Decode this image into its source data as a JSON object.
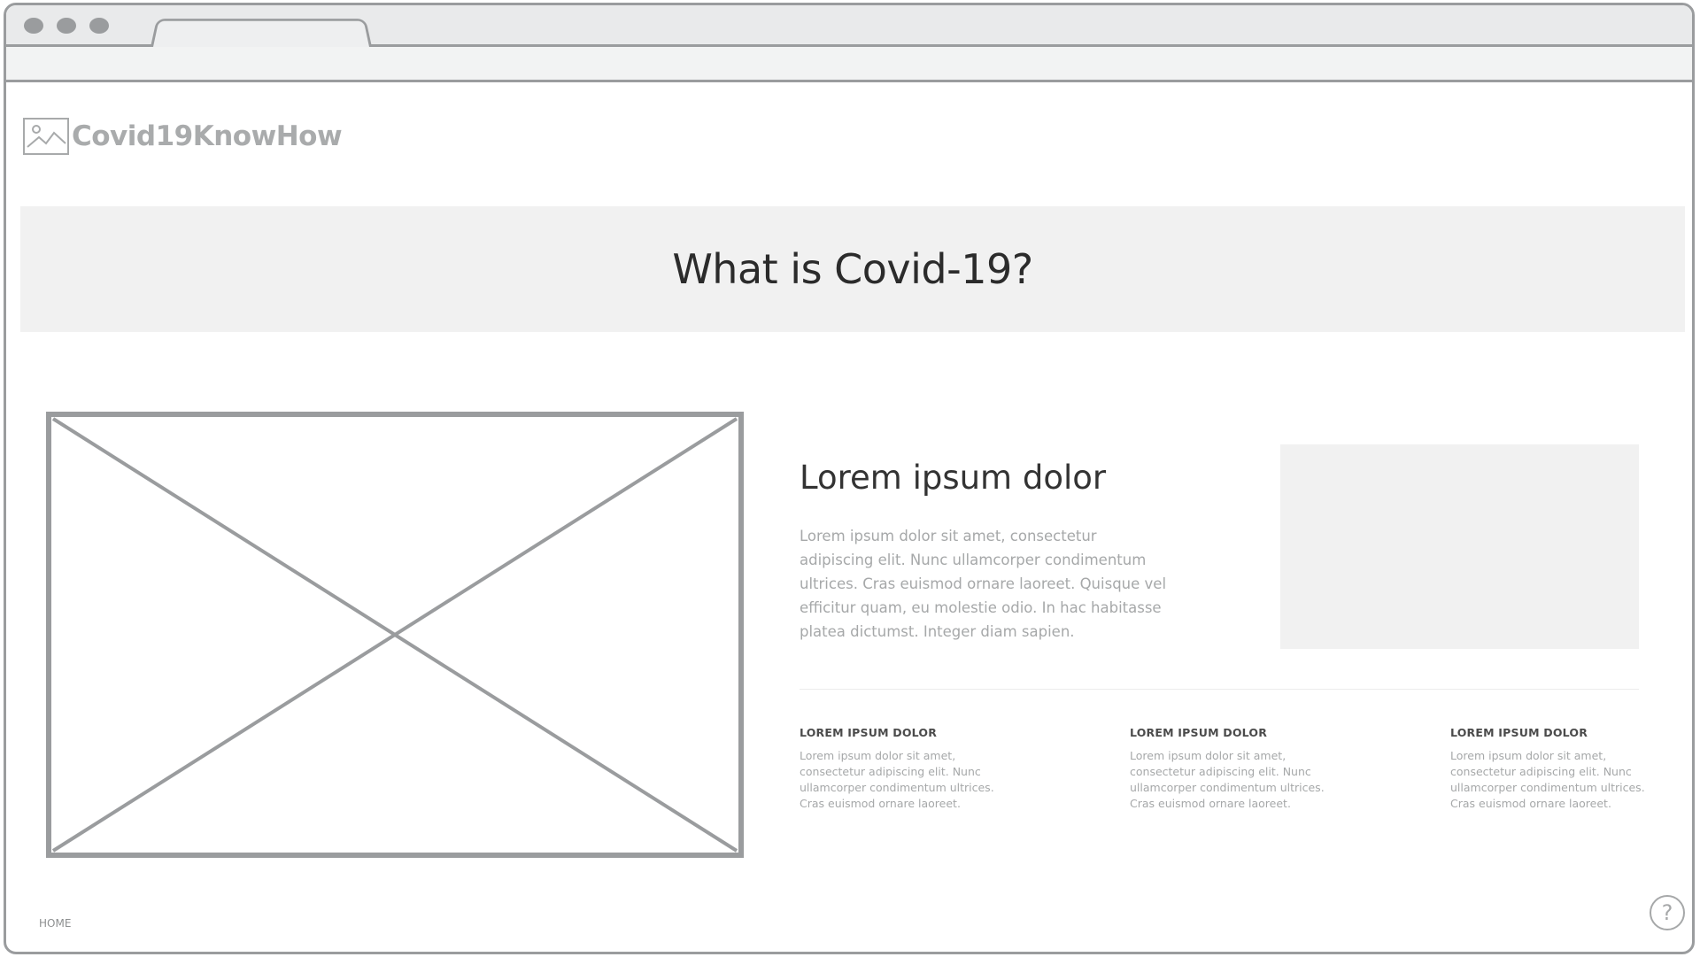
{
  "brand": {
    "name": "Covid19KnowHow",
    "logo_icon": "image-placeholder-icon"
  },
  "hero": {
    "title": "What is Covid-19?"
  },
  "main": {
    "media_icon": "image-placeholder",
    "headline": "Lorem ipsum dolor",
    "body": "Lorem ipsum dolor sit amet, consectetur adipiscing elit. Nunc ullamcorper condimentum ultrices. Cras euismod ornare laoreet. Quisque vel efficitur quam, eu molestie odio. In hac habitasse platea dictumst. Integer diam sapien.",
    "features": [
      {
        "title": "LOREM IPSUM DOLOR",
        "text": "Lorem ipsum dolor sit amet, consectetur adipiscing elit. Nunc ullamcorper condimentum ultrices. Cras euismod ornare laoreet."
      },
      {
        "title": "LOREM IPSUM DOLOR",
        "text": "Lorem ipsum dolor sit amet, consectetur adipiscing elit. Nunc ullamcorper condimentum ultrices. Cras euismod ornare laoreet."
      },
      {
        "title": "LOREM IPSUM DOLOR",
        "text": "Lorem ipsum dolor sit amet, consectetur adipiscing elit. Nunc ullamcorper condimentum ultrices. Cras euismod ornare laoreet."
      }
    ]
  },
  "footer": {
    "home_link": "HOME",
    "help_icon": "question-circle-icon",
    "help_symbol": "?"
  },
  "colors": {
    "wire_stroke": "#9a9c9e",
    "panel_fill": "#f1f1f1",
    "heading_text": "#2b2b2b",
    "muted_text": "#a6a8a9"
  }
}
